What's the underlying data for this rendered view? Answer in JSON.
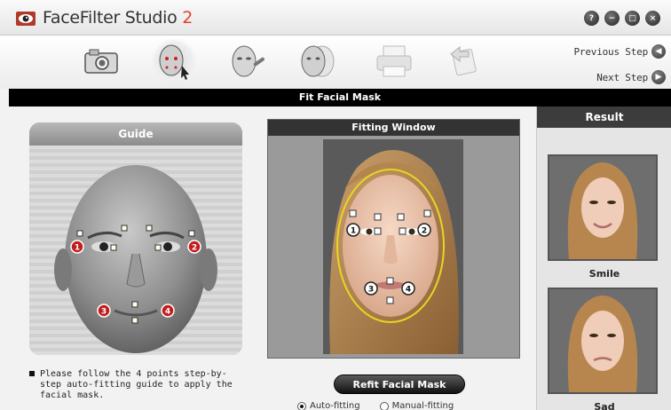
{
  "app": {
    "title": "FaceFilter Studio",
    "version": "2"
  },
  "window_controls": [
    "?",
    "−",
    "□",
    "×"
  ],
  "steps": [
    {
      "name": "camera-icon"
    },
    {
      "name": "face-mask-fit-icon",
      "active": true
    },
    {
      "name": "face-makeup-icon"
    },
    {
      "name": "face-morph-icon"
    },
    {
      "name": "printer-icon"
    },
    {
      "name": "export-icon"
    }
  ],
  "navigation": {
    "previous": "Previous Step",
    "next": "Next Step"
  },
  "section_title": "Fit Facial Mask",
  "guide": {
    "title": "Guide",
    "points": [
      "1",
      "2",
      "3",
      "4"
    ],
    "instructions": "Please follow the 4 points step-by-step auto-fitting guide to apply the facial mask."
  },
  "fitting": {
    "title": "Fitting Window",
    "points": [
      "1",
      "2",
      "3",
      "4"
    ],
    "refit_label": "Refit Facial Mask",
    "modes": [
      {
        "label": "Auto-fitting",
        "selected": true
      },
      {
        "label": "Manual-fitting",
        "selected": false
      }
    ]
  },
  "result": {
    "title": "Result",
    "items": [
      {
        "label": "Smile"
      },
      {
        "label": "Sad"
      }
    ]
  }
}
